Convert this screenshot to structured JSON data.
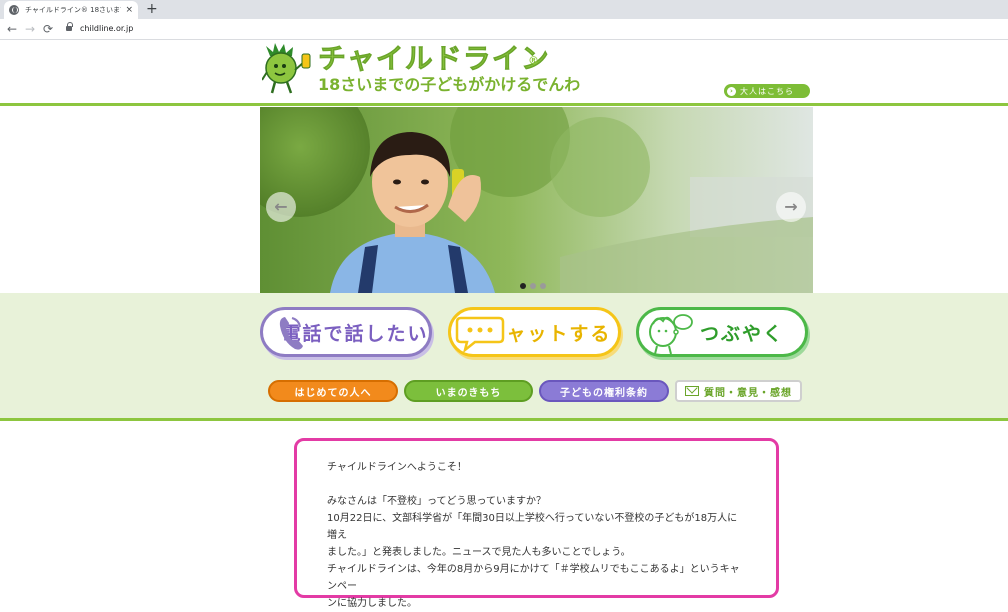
{
  "browser": {
    "tab_title": "チャイルドライン® 18さいまでの子ど",
    "tab_close": "×",
    "new_tab": "+",
    "url": "childline.or.jp"
  },
  "header": {
    "logo_title": "チャイルドライン",
    "logo_reg": "®",
    "logo_subtitle": "18さいまでの子どもがかけるでんわ",
    "adult_link": "大人はこちら"
  },
  "hero": {
    "slide_count": 3,
    "active_slide": 1,
    "prev_label": "←",
    "next_label": "→"
  },
  "main_buttons": {
    "phone": "電話で話したい",
    "chat": "チャットする",
    "mutter": "つぶやく"
  },
  "sub_buttons": {
    "first_time": "はじめての人へ",
    "feelings": "いまのきもち",
    "rights": "子どもの権利条約",
    "opinion": "質問・意見・感想"
  },
  "content": {
    "line1": "チャイルドラインへようこそ！",
    "line2": "みなさんは「不登校」ってどう思っていますか？",
    "line3": "10月22日に、文部科学省が「年間30日以上学校へ行っていない不登校の子どもが18万人に増え",
    "line4": "ました。」と発表しました。ニュースで見た人も多いことでしょう。",
    "line5": "チャイルドラインは、今年の8月から9月にかけて「＃学校ムリでもここあるよ」というキャンペー",
    "line6": "ンに協力しました。"
  },
  "colors": {
    "brand_green": "#8dc63f",
    "phone_purple": "#8e7cc3",
    "chat_yellow": "#f5c518",
    "mutter_green": "#4cb848",
    "orange": "#f28a1c",
    "content_border": "#e33ba5"
  }
}
